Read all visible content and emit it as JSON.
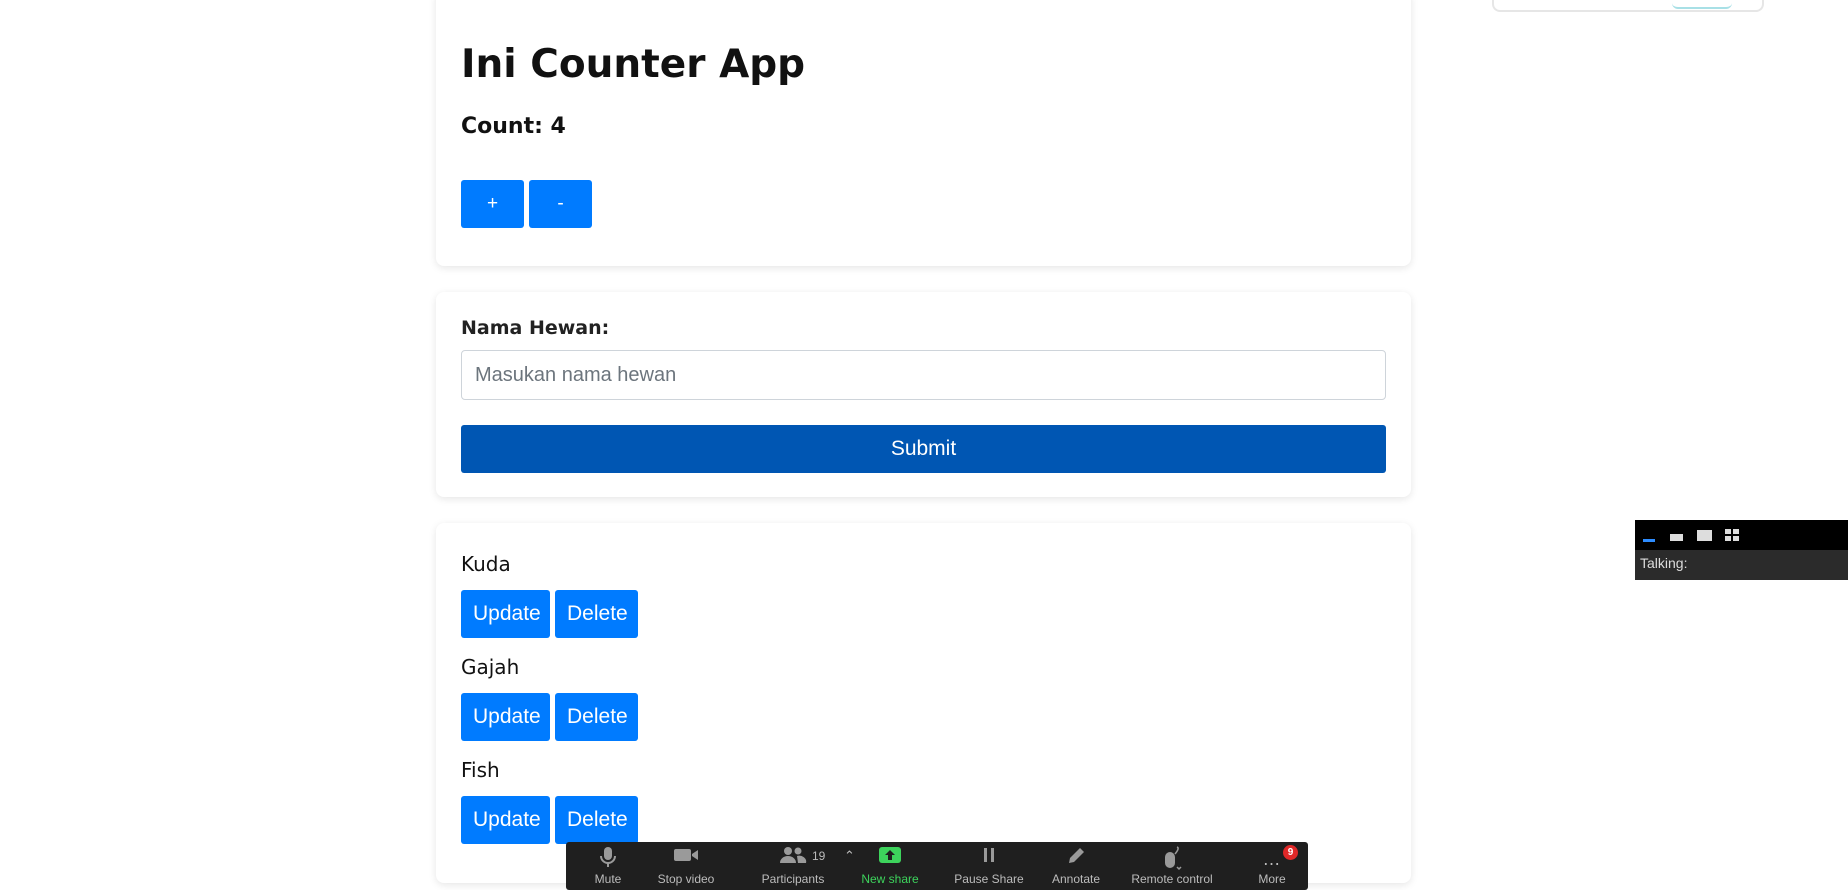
{
  "counter": {
    "title": "Ini Counter App",
    "count_text": "Count: 4",
    "increment_label": "+",
    "decrement_label": "-"
  },
  "form": {
    "label": "Nama Hewan:",
    "input_placeholder": "Masukan nama hewan",
    "input_value": "",
    "submit_label": "Submit"
  },
  "animals": [
    {
      "name": "Kuda",
      "update_label": "Update",
      "delete_label": "Delete"
    },
    {
      "name": "Gajah",
      "update_label": "Update",
      "delete_label": "Delete"
    },
    {
      "name": "Fish",
      "update_label": "Update",
      "delete_label": "Delete"
    }
  ],
  "zoom_toolbar": {
    "mute": "Mute",
    "stop_video": "Stop video",
    "participants": "Participants",
    "participants_count": "19",
    "new_share": "New share",
    "pause_share": "Pause Share",
    "annotate": "Annotate",
    "remote_control": "Remote control",
    "more": "More",
    "more_badge": "9"
  },
  "mini_panel": {
    "talking": "Talking:"
  },
  "colors": {
    "primary": "#007bff",
    "submit": "#0056b3",
    "toolbar_bg": "#1f1f1f",
    "share_green": "#3dd35c",
    "badge_red": "#e02828"
  }
}
